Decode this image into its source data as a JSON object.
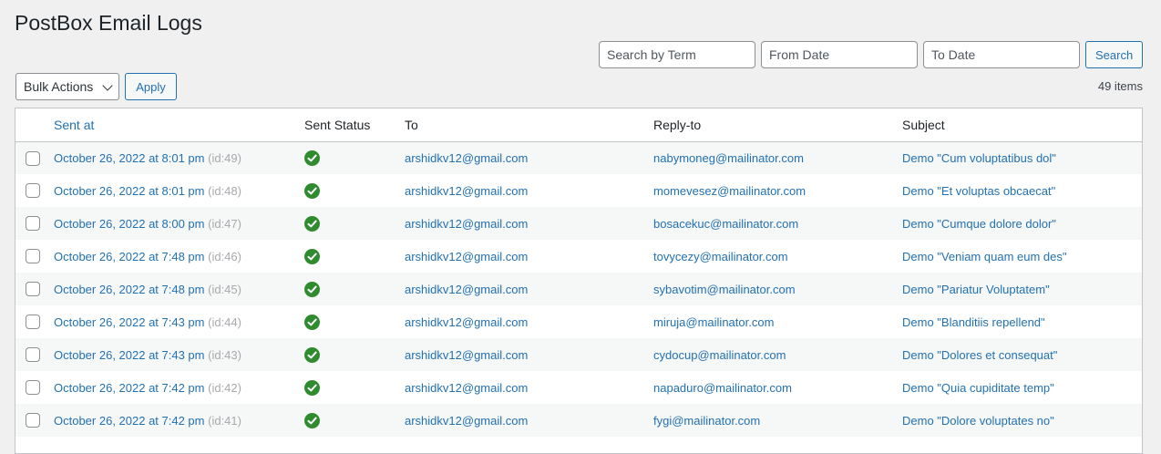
{
  "page": {
    "title": "PostBox Email Logs"
  },
  "search": {
    "term_placeholder": "Search by Term",
    "from_placeholder": "From Date",
    "to_placeholder": "To Date",
    "button_label": "Search"
  },
  "tablenav": {
    "bulk_actions_label": "Bulk Actions",
    "apply_label": "Apply",
    "items_count": "49 items"
  },
  "table": {
    "columns": {
      "sent_at": "Sent at",
      "sent_status": "Sent Status",
      "to": "To",
      "reply_to": "Reply-to",
      "subject": "Subject"
    },
    "status_icon": "check-circle-icon",
    "status_color": "#2e8b2e",
    "rows": [
      {
        "sent_at": "October 26, 2022 at 8:01 pm",
        "id": "(id:49)",
        "to": "arshidkv12@gmail.com",
        "reply_to": "nabymoneg@mailinator.com",
        "subject": "Demo \"Cum voluptatibus dol\""
      },
      {
        "sent_at": "October 26, 2022 at 8:01 pm",
        "id": "(id:48)",
        "to": "arshidkv12@gmail.com",
        "reply_to": "momevesez@mailinator.com",
        "subject": "Demo \"Et voluptas obcaecat\""
      },
      {
        "sent_at": "October 26, 2022 at 8:00 pm",
        "id": "(id:47)",
        "to": "arshidkv12@gmail.com",
        "reply_to": "bosacekuc@mailinator.com",
        "subject": "Demo \"Cumque dolore dolor\""
      },
      {
        "sent_at": "October 26, 2022 at 7:48 pm",
        "id": "(id:46)",
        "to": "arshidkv12@gmail.com",
        "reply_to": "tovycezy@mailinator.com",
        "subject": "Demo \"Veniam quam eum des\""
      },
      {
        "sent_at": "October 26, 2022 at 7:48 pm",
        "id": "(id:45)",
        "to": "arshidkv12@gmail.com",
        "reply_to": "sybavotim@mailinator.com",
        "subject": "Demo \"Pariatur Voluptatem\""
      },
      {
        "sent_at": "October 26, 2022 at 7:43 pm",
        "id": "(id:44)",
        "to": "arshidkv12@gmail.com",
        "reply_to": "miruja@mailinator.com",
        "subject": "Demo \"Blanditiis repellend\""
      },
      {
        "sent_at": "October 26, 2022 at 7:43 pm",
        "id": "(id:43)",
        "to": "arshidkv12@gmail.com",
        "reply_to": "cydocup@mailinator.com",
        "subject": "Demo \"Dolores et consequat\""
      },
      {
        "sent_at": "October 26, 2022 at 7:42 pm",
        "id": "(id:42)",
        "to": "arshidkv12@gmail.com",
        "reply_to": "napaduro@mailinator.com",
        "subject": "Demo \"Quia cupiditate temp\""
      },
      {
        "sent_at": "October 26, 2022 at 7:42 pm",
        "id": "(id:41)",
        "to": "arshidkv12@gmail.com",
        "reply_to": "fygi@mailinator.com",
        "subject": "Demo \"Dolore voluptates no\""
      }
    ]
  }
}
